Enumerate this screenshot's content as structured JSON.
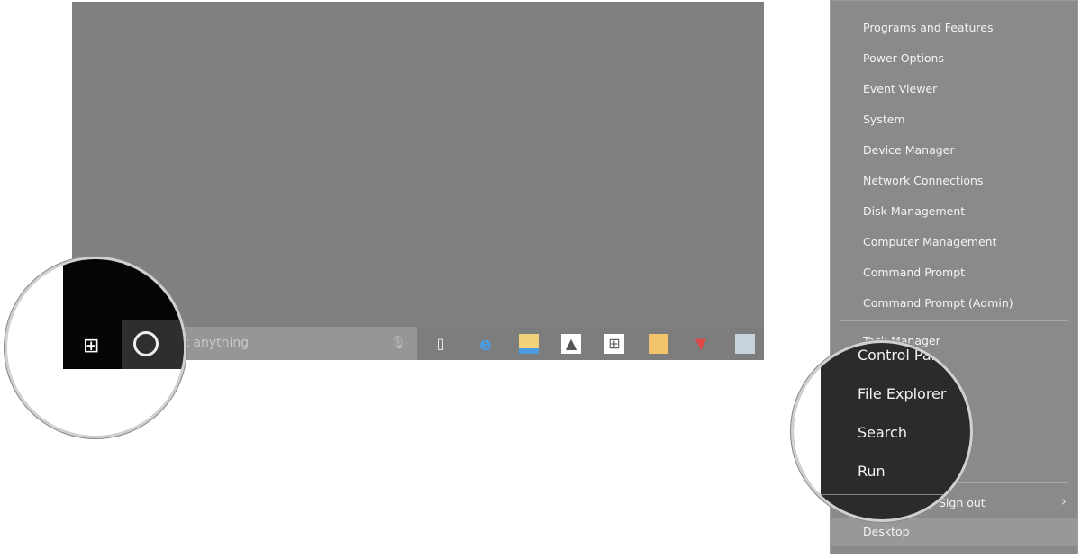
{
  "taskbar": {
    "search_placeholder": "Ask anything",
    "icons": [
      "task-view-icon",
      "edge-icon",
      "file-explorer-icon",
      "photos-icon",
      "store-icon",
      "app-icon",
      "vivaldi-icon",
      "remote-desktop-icon"
    ]
  },
  "menu": {
    "items": [
      "Programs and Features",
      "Power Options",
      "Event Viewer",
      "System",
      "Device Manager",
      "Network Connections",
      "Disk Management",
      "Computer Management",
      "Command Prompt",
      "Command Prompt (Admin)"
    ],
    "task_manager": "Task Manager",
    "sign_out": "Sign out",
    "desktop": "Desktop"
  },
  "magnified": {
    "items": [
      "Control Panel",
      "File Explorer",
      "Search",
      "Run"
    ]
  },
  "colors": {
    "menu_bg": "#8a8a8a",
    "magnifier_bg": "#2b2b2b",
    "screen_bg": "#808080"
  }
}
